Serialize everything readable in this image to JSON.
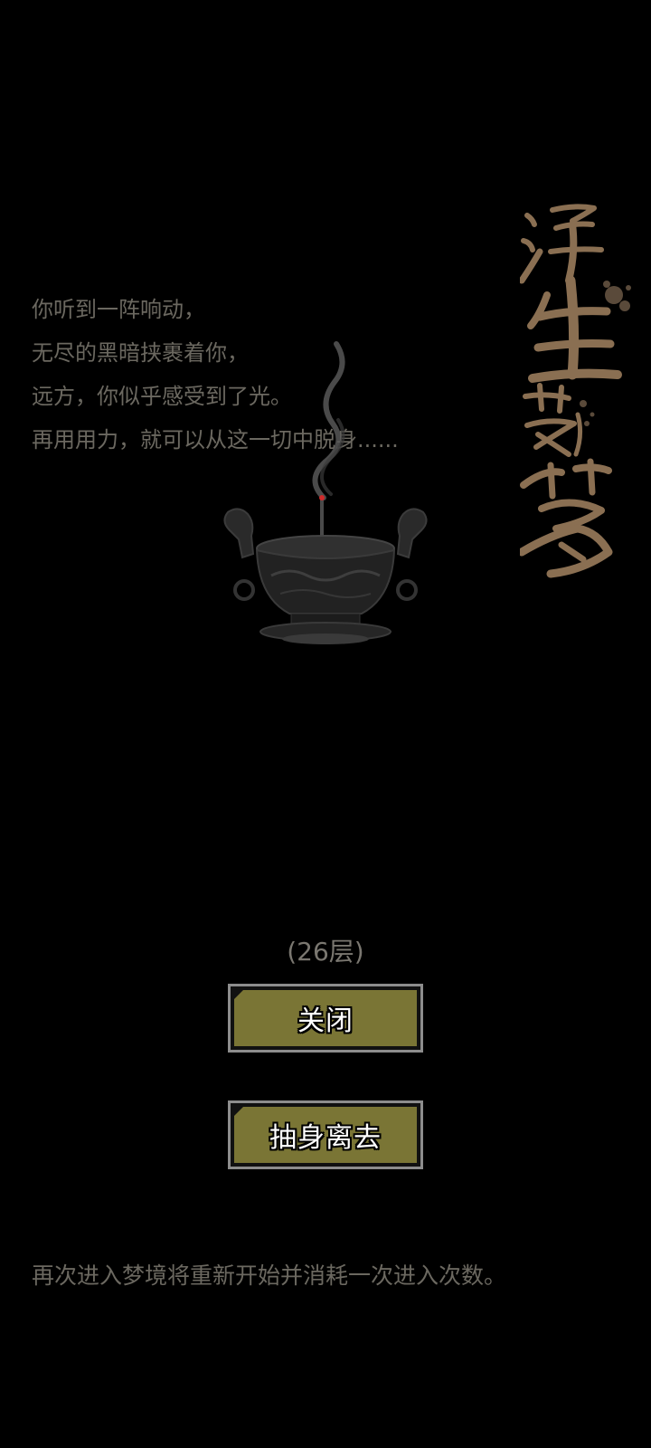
{
  "narrative": {
    "lines": [
      "你听到一阵响动，",
      "无尽的黑暗挟裹着你，",
      "远方，你似乎感受到了光。",
      "再用用力，就可以从这一切中脱身......"
    ]
  },
  "title_art": {
    "text": "浮生若梦",
    "color": "#8a6f52"
  },
  "burner": {
    "icon": "incense-burner-icon",
    "ember_color": "#d02a2a"
  },
  "floor": {
    "label": "(26层)"
  },
  "buttons": {
    "close_label": "关闭",
    "leave_label": "抽身离去",
    "fill_color": "#7a7535",
    "border_color": "#8d8d8d"
  },
  "notice": {
    "text": "再次进入梦境将重新开始并消耗一次进入次数。"
  }
}
